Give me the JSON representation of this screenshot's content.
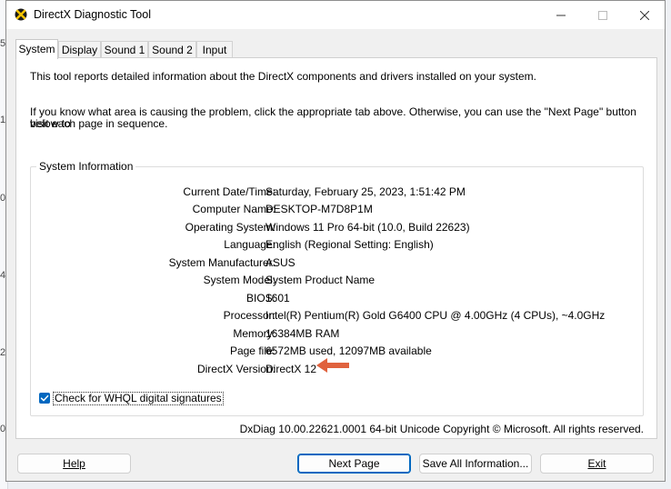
{
  "background_ticks": [
    "5",
    "1",
    "0",
    "4",
    "2",
    "0"
  ],
  "window": {
    "title": "DirectX Diagnostic Tool"
  },
  "tabs": [
    {
      "label": "System",
      "active": true
    },
    {
      "label": "Display",
      "active": false
    },
    {
      "label": "Sound 1",
      "active": false
    },
    {
      "label": "Sound 2",
      "active": false
    },
    {
      "label": "Input",
      "active": false
    }
  ],
  "intro": {
    "line1": "This tool reports detailed information about the DirectX components and drivers installed on your system.",
    "line2a": "If you know what area is causing the problem, click the appropriate tab above.  Otherwise, you can use the \"Next Page\" button below to",
    "line2b": "visit each page in sequence."
  },
  "system_info": {
    "legend": "System Information",
    "rows": [
      {
        "label": "Current Date/Time:",
        "value": "Saturday, February 25, 2023, 1:51:42 PM"
      },
      {
        "label": "Computer Name:",
        "value": "DESKTOP-M7D8P1M"
      },
      {
        "label": "Operating System:",
        "value": "Windows 11 Pro 64-bit (10.0, Build 22623)"
      },
      {
        "label": "Language:",
        "value": "English (Regional Setting: English)"
      },
      {
        "label": "System Manufacturer:",
        "value": "ASUS"
      },
      {
        "label": "System Model:",
        "value": "System Product Name"
      },
      {
        "label": "BIOS:",
        "value": "1601"
      },
      {
        "label": "Processor:",
        "value": "Intel(R) Pentium(R) Gold G6400 CPU @ 4.00GHz (4 CPUs), ~4.0GHz"
      },
      {
        "label": "Memory:",
        "value": "16384MB RAM"
      },
      {
        "label": "Page file:",
        "value": "6572MB used, 12097MB available"
      },
      {
        "label": "DirectX Version:",
        "value": "DirectX 12"
      }
    ]
  },
  "whql_checkbox": {
    "label": "Check for WHQL digital signatures",
    "checked": true
  },
  "footer": {
    "version_text": "DxDiag 10.00.22621.0001 64-bit Unicode  Copyright © Microsoft. All rights reserved."
  },
  "buttons": {
    "help": "Help",
    "next_page": "Next Page",
    "save_all": "Save All Information...",
    "exit": "Exit"
  },
  "colors": {
    "accent": "#0067c0",
    "arrow": "#e0623e"
  }
}
